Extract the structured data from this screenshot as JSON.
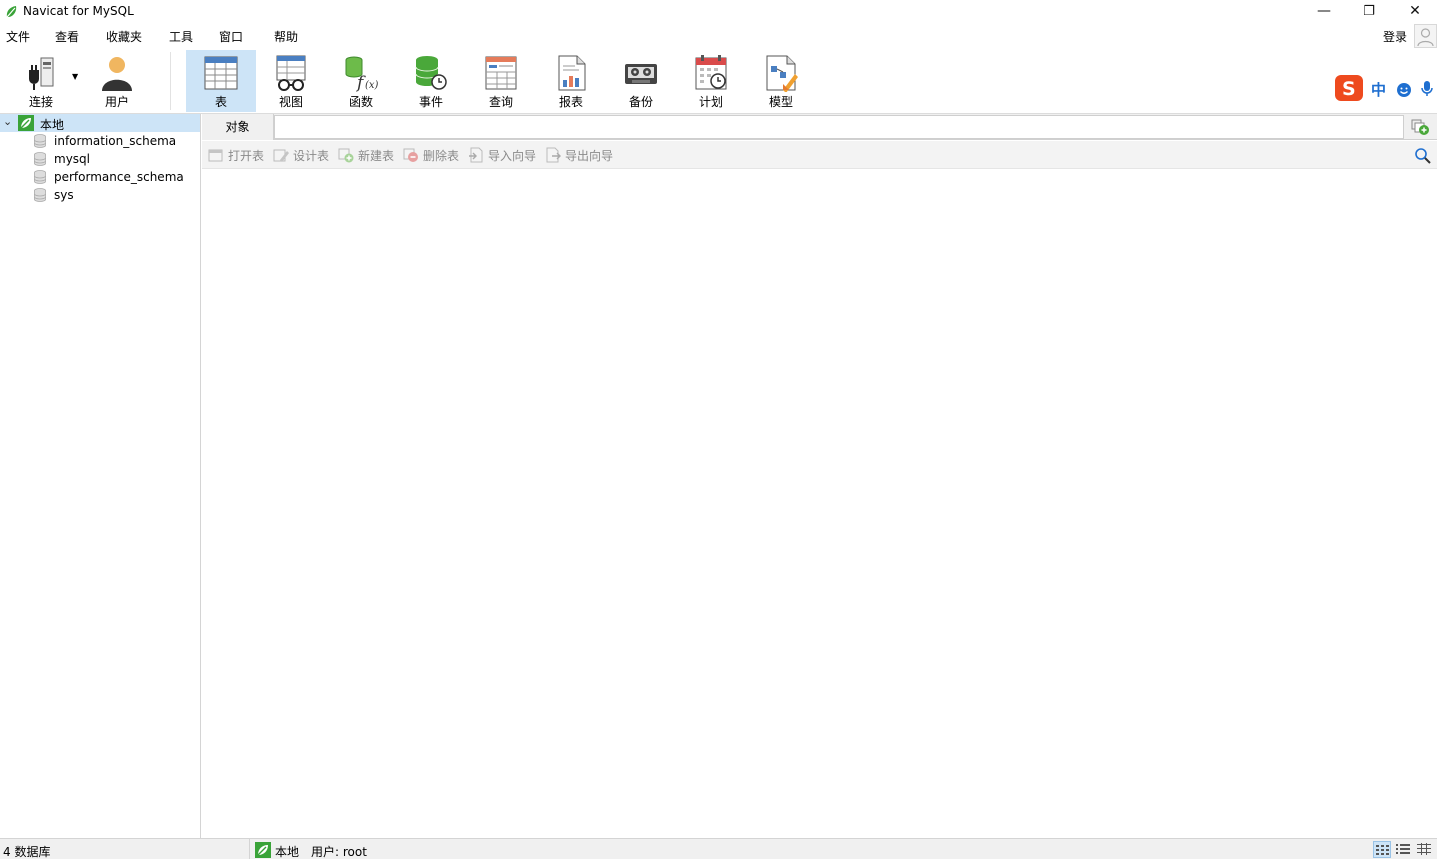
{
  "window": {
    "title": "Navicat for MySQL",
    "minimize": "—",
    "restore": "❐",
    "close": "✕"
  },
  "menu": {
    "items": [
      "文件",
      "查看",
      "收藏夹",
      "工具",
      "窗口",
      "帮助"
    ],
    "login": "登录"
  },
  "toolbar": {
    "items": [
      {
        "label": "连接",
        "icon": "plug-icon"
      },
      {
        "label": "用户",
        "icon": "user-icon"
      },
      {
        "label": "表",
        "icon": "table-icon",
        "active": true
      },
      {
        "label": "视图",
        "icon": "view-icon"
      },
      {
        "label": "函数",
        "icon": "function-icon"
      },
      {
        "label": "事件",
        "icon": "event-icon"
      },
      {
        "label": "查询",
        "icon": "query-icon"
      },
      {
        "label": "报表",
        "icon": "report-icon"
      },
      {
        "label": "备份",
        "icon": "backup-icon"
      },
      {
        "label": "计划",
        "icon": "schedule-icon"
      },
      {
        "label": "模型",
        "icon": "model-icon"
      }
    ]
  },
  "ime": {
    "lang": "中"
  },
  "sidebar": {
    "connection": "本地",
    "databases": [
      "information_schema",
      "mysql",
      "performance_schema",
      "sys"
    ]
  },
  "main": {
    "tab": "对象",
    "actions": [
      {
        "label": "打开表",
        "icon": "open-table-icon"
      },
      {
        "label": "设计表",
        "icon": "design-table-icon"
      },
      {
        "label": "新建表",
        "icon": "new-table-icon"
      },
      {
        "label": "删除表",
        "icon": "delete-table-icon"
      },
      {
        "label": "导入向导",
        "icon": "import-wizard-icon"
      },
      {
        "label": "导出向导",
        "icon": "export-wizard-icon"
      }
    ]
  },
  "status": {
    "db_count": "4 数据库",
    "connection": "本地",
    "user": "用户: root"
  },
  "colors": {
    "selection": "#cde4f7",
    "navicat_green": "#3aa339",
    "table_blue": "#4a7fc1"
  }
}
